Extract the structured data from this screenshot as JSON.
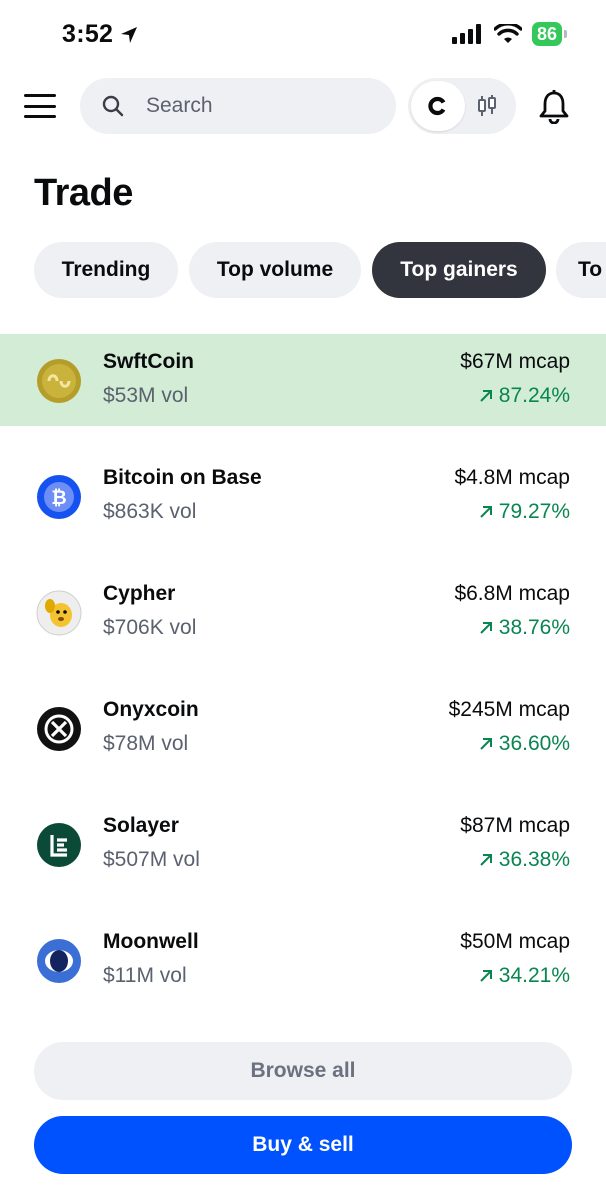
{
  "status_bar": {
    "time": "3:52",
    "battery": "86"
  },
  "header": {
    "search_placeholder": "Search"
  },
  "page_title": "Trade",
  "tabs": [
    {
      "label": "Trending",
      "active": false
    },
    {
      "label": "Top volume",
      "active": false
    },
    {
      "label": "Top gainers",
      "active": true
    },
    {
      "label": "To",
      "active": false
    }
  ],
  "assets": [
    {
      "name": "SwftCoin",
      "vol": "$53M vol",
      "mcap": "$67M mcap",
      "change": "87.24%",
      "icon": "swftcoin-icon",
      "highlighted": true
    },
    {
      "name": "Bitcoin on Base",
      "vol": "$863K vol",
      "mcap": "$4.8M mcap",
      "change": "79.27%",
      "icon": "bitcoin-on-base-icon",
      "highlighted": false
    },
    {
      "name": "Cypher",
      "vol": "$706K vol",
      "mcap": "$6.8M mcap",
      "change": "38.76%",
      "icon": "cypher-icon",
      "highlighted": false
    },
    {
      "name": "Onyxcoin",
      "vol": "$78M vol",
      "mcap": "$245M mcap",
      "change": "36.60%",
      "icon": "onyxcoin-icon",
      "highlighted": false
    },
    {
      "name": "Solayer",
      "vol": "$507M vol",
      "mcap": "$87M mcap",
      "change": "36.38%",
      "icon": "solayer-icon",
      "highlighted": false
    },
    {
      "name": "Moonwell",
      "vol": "$11M vol",
      "mcap": "$50M mcap",
      "change": "34.21%",
      "icon": "moonwell-icon",
      "highlighted": false
    }
  ],
  "buttons": {
    "browse_all": "Browse all",
    "buy_sell": "Buy & sell"
  },
  "colors": {
    "accent": "#0052ff",
    "positive": "#098551",
    "highlight_row": "#d3ecd6",
    "active_tab": "#32353d"
  }
}
